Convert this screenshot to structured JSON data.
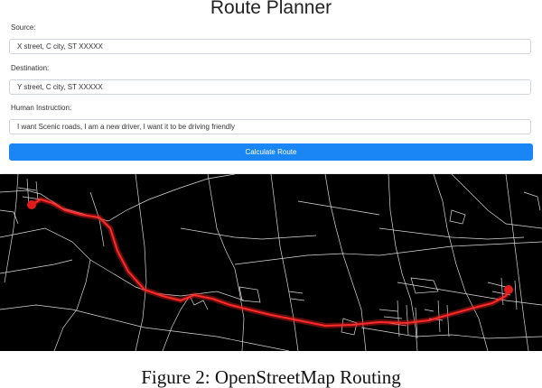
{
  "app": {
    "title": "Route Planner",
    "source": {
      "label": "Source:",
      "value": "X street, C city, ST XXXXX"
    },
    "destination": {
      "label": "Destination:",
      "value": "Y street, C city, ST XXXXX"
    },
    "instruction": {
      "label": "Human Instruction:",
      "value": "I want Scenic roads, I am a new driver, I want it to be driving friendly"
    },
    "calculate_label": "Calculate Route",
    "accent_color": "#1a86f5"
  },
  "map": {
    "background": "#000000",
    "road_color": "#d9d9d9",
    "route_color": "#e01b1b"
  },
  "caption": "Figure 2: OpenStreetMap Routing"
}
